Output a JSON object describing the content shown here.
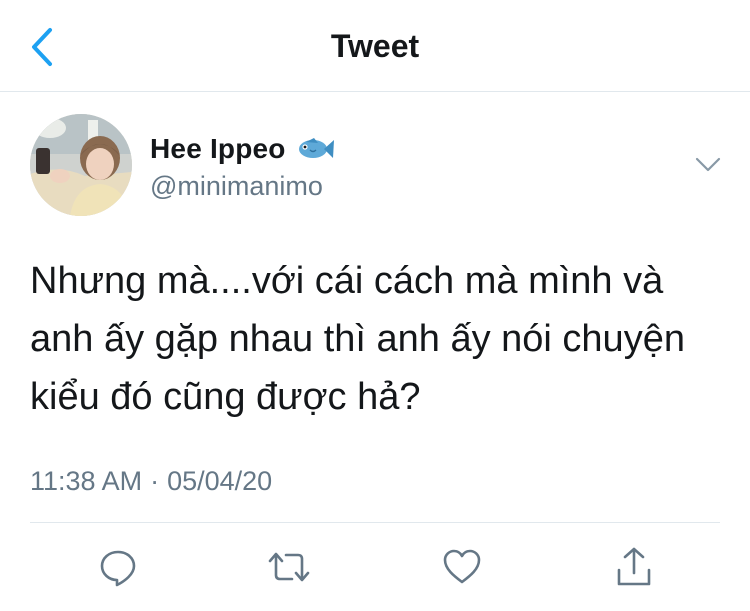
{
  "header": {
    "title": "Tweet"
  },
  "author": {
    "display_name": "Hee Ippeo",
    "handle": "@minimanimo"
  },
  "tweet": {
    "lines": [
      "Nhưng mà....với cái cách mà mình và",
      "anh ấy gặp nhau thì anh ấy nói chuyện",
      "kiểu đó cũng được hả?"
    ],
    "time": "11:38 AM",
    "separator": "·",
    "date": "05/04/20"
  },
  "icons": {
    "back": "chevron-left-icon",
    "badge": "fish-emoji-icon",
    "more": "chevron-down-icon",
    "reply": "reply-icon",
    "retweet": "retweet-icon",
    "like": "heart-icon",
    "share": "share-icon"
  },
  "colors": {
    "accent": "#1da1f2",
    "text": "#14171a",
    "secondary": "#657786",
    "divider": "#e1e8ed"
  }
}
